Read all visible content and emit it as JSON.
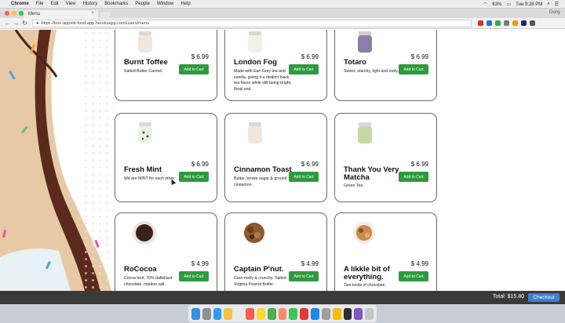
{
  "menubar": {
    "app": "Chrome",
    "items": [
      "File",
      "Edit",
      "View",
      "History",
      "Bookmarks",
      "People",
      "Window",
      "Help"
    ],
    "battery": "63%",
    "clock": "Tue 9:28 PM"
  },
  "browser": {
    "tab_title": "Menu",
    "profile": "Dony",
    "url": "https://bon-appetit-food-app.herokuapp.com/users/menu"
  },
  "menu": {
    "items": [
      {
        "name": "Burnt Toffee",
        "price": "$ 6.99",
        "button": "Add to Cart",
        "desc": "Salted Butter Carmel."
      },
      {
        "name": "London Fog",
        "price": "$ 6.99",
        "button": "Add to Cart",
        "desc": "Made with Earl Grey tea and vanilla, giving it a distinct black tea flavor while still being bright, floral and"
      },
      {
        "name": "Totaro",
        "price": "$ 6.99",
        "button": "Add to Cart",
        "desc": "Sweet, starchy, light and nutty."
      },
      {
        "name": "Fresh Mint",
        "price": "$ 6.99",
        "button": "Add to Cart",
        "desc": "We are MINT for each other."
      },
      {
        "name": "Cinnamon Toast",
        "price": "$ 6.99",
        "button": "Add to Cart",
        "desc": "Butter, brown sugar & ground cinnamon."
      },
      {
        "name": "Thank You Very Matcha",
        "price": "$ 6.99",
        "button": "Add to Cart",
        "desc": "Green Tea."
      },
      {
        "name": "RoCocoa",
        "price": "$ 4.99",
        "button": "Add to Cart",
        "desc": "Cocoa brut, 70% dallebaut chocolate, maldon salt."
      },
      {
        "name": "Captain P'nut.",
        "price": "$ 4.99",
        "button": "Add to Cart",
        "desc": "Care-melly & crunchy. Salted Virginia Peanut Brittle."
      },
      {
        "name": "A likkle bit of everything.",
        "price": "$ 4.99",
        "button": "Add to Cart",
        "desc": "Two kinds of chocolate,"
      }
    ]
  },
  "cart": {
    "total": "Total: $15.80",
    "checkout": "Checkout"
  },
  "colors": {
    "add_button": "#2e9a3e",
    "checkout_button": "#3d7fd1",
    "cart_bar": "#3a3a3a"
  }
}
